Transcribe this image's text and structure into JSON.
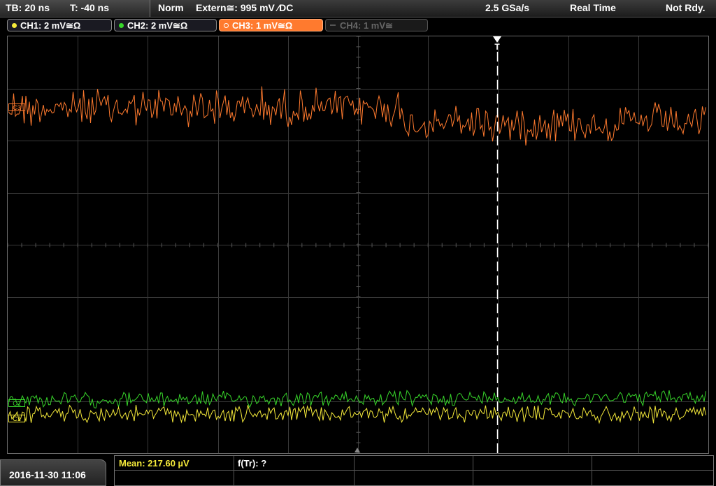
{
  "topbar": {
    "timebase": "TB: 20 ns",
    "trigger_time": "T: -40 ns",
    "mode": "Norm",
    "trigger_source": "Extern≅: 995 mV ⁄DC",
    "sample_rate": "2.5 GSa/s",
    "acq_mode": "Real Time",
    "status": "Not Rdy."
  },
  "channels": [
    {
      "label": "CH1: 2 mV≅Ω",
      "color": "#f5ea3a",
      "state": "on"
    },
    {
      "label": "CH2: 2 mV≅Ω",
      "color": "#37d62a",
      "state": "on"
    },
    {
      "label": "CH3: 1 mV≅Ω",
      "color": "#ff7a2e",
      "state": "selected"
    },
    {
      "label": "CH4: 1 mV≅",
      "color": "#666666",
      "state": "off"
    }
  ],
  "markers": {
    "trigger": "T",
    "ch1": "C1",
    "ch2": "C2",
    "ch3": "C3"
  },
  "bottombar": {
    "datetime": "2016-11-30 11:06",
    "measurement_mean": "Mean: 217.60 µV",
    "measurement_freq": "f(Tr): ?"
  },
  "colors": {
    "ch1": "#f5ea3a",
    "ch2": "#37d62a",
    "ch3": "#ff7a2e",
    "grid": "#3a3a3a",
    "meas_text": "#f5ea3a"
  }
}
